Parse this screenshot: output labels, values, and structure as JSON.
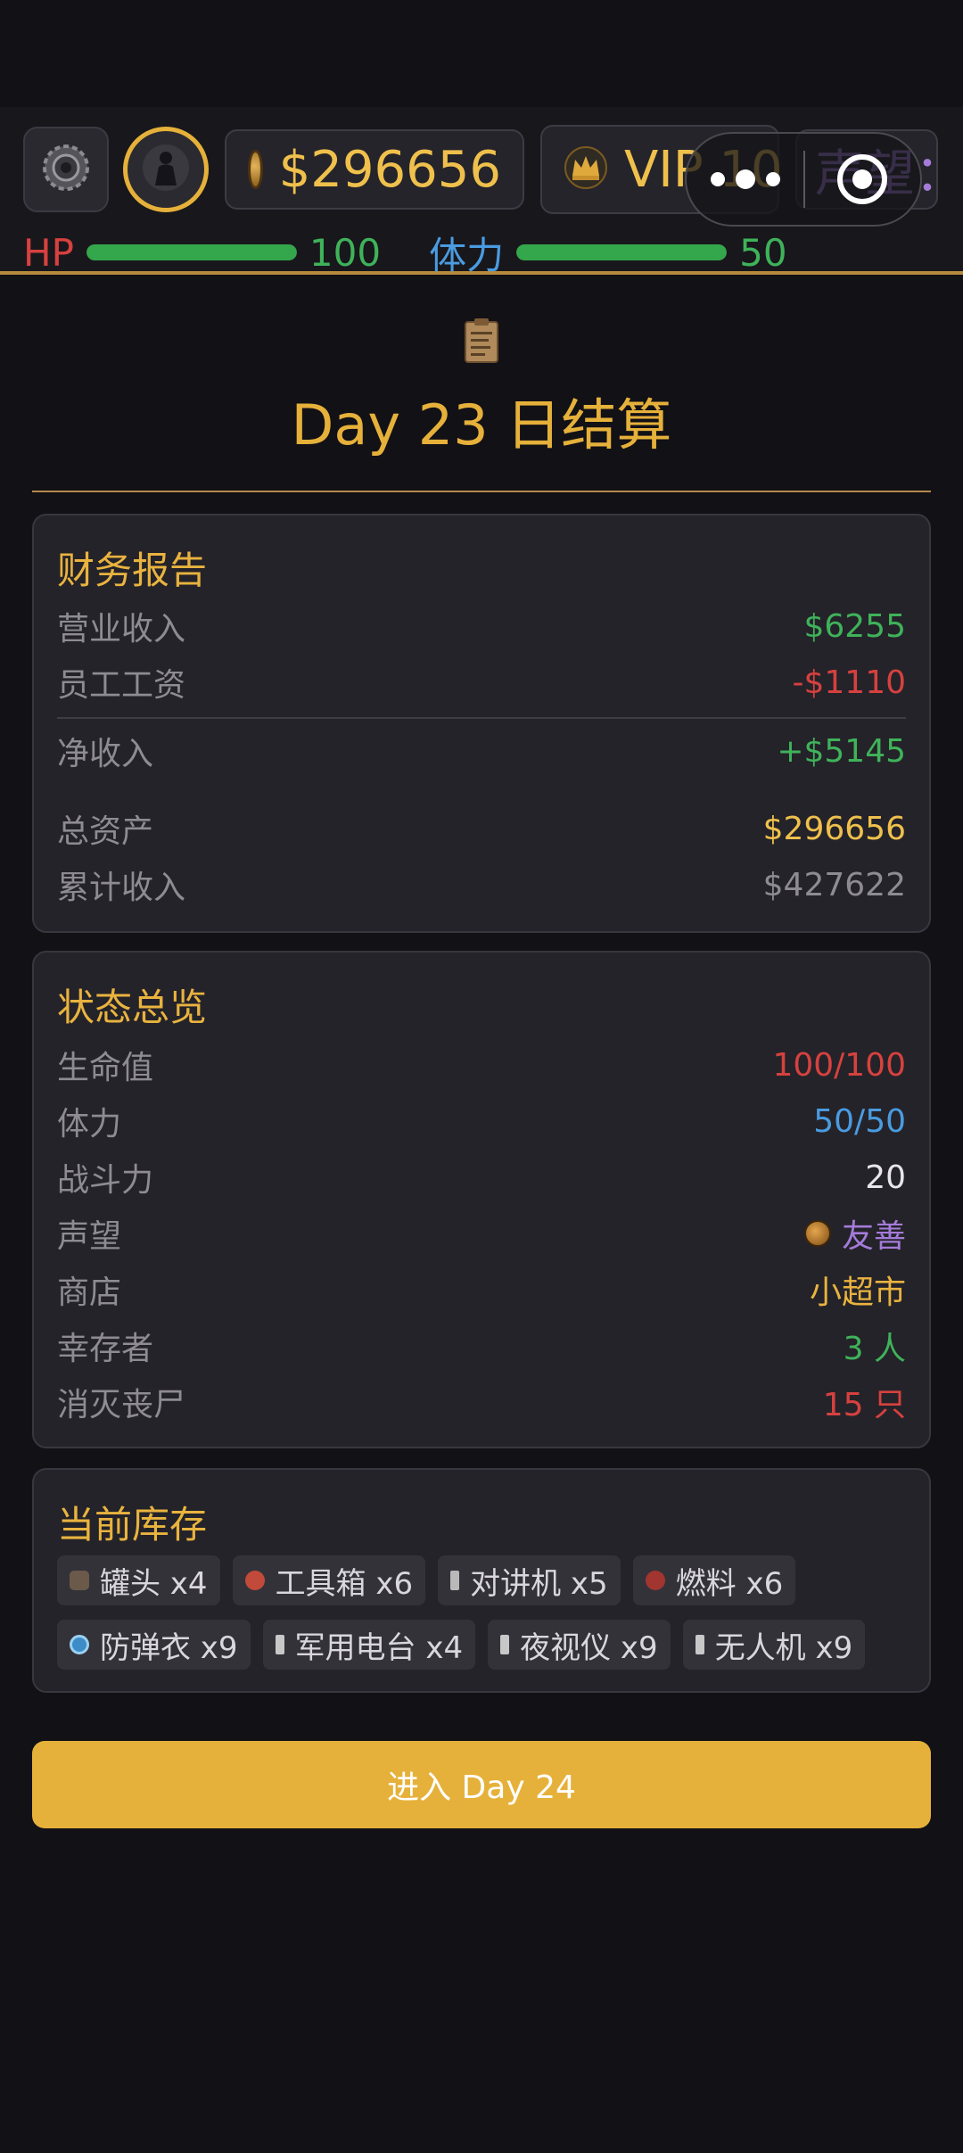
{
  "hud": {
    "money": "$296656",
    "vip": "VIP 10",
    "reputation_partial": "声望：",
    "hp_label": "HP",
    "hp_value": "100",
    "hp_fraction": 1.0,
    "stamina_label": "体力",
    "stamina_value": "50",
    "stamina_fraction": 1.0,
    "icons": [
      "gear-icon",
      "character-avatar-icon",
      "coin-icon",
      "crown-icon",
      "more-dots-icon",
      "target-close-icon"
    ]
  },
  "title": "Day 23 日结算",
  "finance": {
    "title": "财务报告",
    "rows": [
      {
        "label": "营业收入",
        "value": "$6255",
        "color": "#3fb25a"
      },
      {
        "label": "员工工资",
        "value": "-$1110",
        "color": "#d6413f"
      },
      {
        "label": "净收入",
        "value": "+$5145",
        "color": "#3fb25a"
      },
      {
        "label": "总资产",
        "value": "$296656",
        "color": "#efc04c"
      },
      {
        "label": "累计收入",
        "value": "$427622",
        "color": "#8e8b93"
      }
    ]
  },
  "status": {
    "title": "状态总览",
    "rows": [
      {
        "label": "生命值",
        "value": "100/100",
        "color": "#d6413f"
      },
      {
        "label": "体力",
        "value": "50/50",
        "color": "#4a9be0"
      },
      {
        "label": "战斗力",
        "value": "20",
        "color": "#e8e6ea"
      },
      {
        "label": "声望",
        "value": "友善",
        "color": "#a47bd9"
      },
      {
        "label": "商店",
        "value": "小超市",
        "color": "#e9b33f"
      },
      {
        "label": "幸存者",
        "value": "3 人",
        "color": "#3fb25a"
      },
      {
        "label": "消灭丧尸",
        "value": "15 只",
        "color": "#d6413f"
      }
    ]
  },
  "inventory": {
    "title": "当前库存",
    "items": [
      {
        "label": "罐头 x4",
        "icon": "can-icon"
      },
      {
        "label": "工具箱 x6",
        "icon": "toolbox-icon"
      },
      {
        "label": "对讲机 x5",
        "icon": "walkie-talkie-icon"
      },
      {
        "label": "燃料 x6",
        "icon": "fuel-icon"
      },
      {
        "label": "防弹衣 x9",
        "icon": "vest-icon"
      },
      {
        "label": "军用电台 x4",
        "icon": "military-radio-icon"
      },
      {
        "label": "夜视仪 x9",
        "icon": "night-vision-icon"
      },
      {
        "label": "无人机 x9",
        "icon": "drone-icon"
      }
    ]
  },
  "next_button": "进入 Day 24",
  "colors": {
    "accent": "#e6b13a",
    "background": "#121116",
    "card": "#242329",
    "positive": "#3fb25a",
    "negative": "#d6413f"
  }
}
